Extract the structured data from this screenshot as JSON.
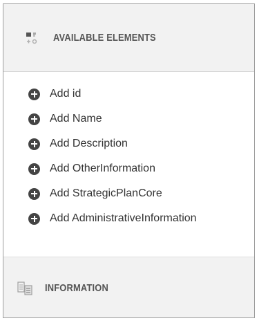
{
  "available_elements": {
    "title": "AVAILABLE ELEMENTS",
    "icon": "elements-grid-icon",
    "items": [
      {
        "label": "Add id",
        "icon": "add-circle-icon"
      },
      {
        "label": "Add Name",
        "icon": "add-circle-icon"
      },
      {
        "label": "Add Description",
        "icon": "add-circle-icon"
      },
      {
        "label": "Add OtherInformation",
        "icon": "add-circle-icon"
      },
      {
        "label": "Add StrategicPlanCore",
        "icon": "add-circle-icon"
      },
      {
        "label": "Add AdministrativeInformation",
        "icon": "add-circle-icon"
      }
    ]
  },
  "information": {
    "title": "INFORMATION",
    "icon": "document-list-icon"
  },
  "colors": {
    "header_bg": "#f2f2f2",
    "header_text": "#555555",
    "item_text": "#333333",
    "plus_icon": "#444444"
  }
}
